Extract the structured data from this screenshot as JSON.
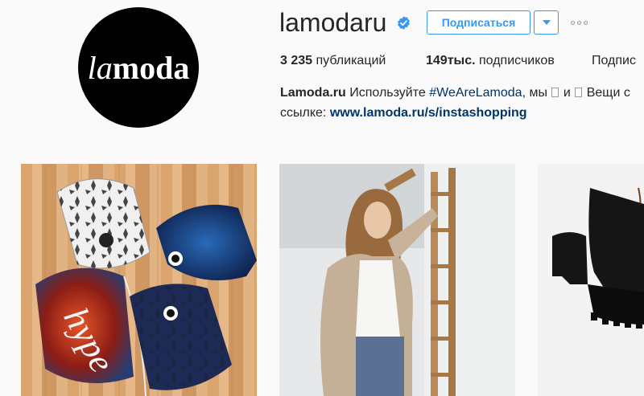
{
  "profile": {
    "logo_text_italic": "la",
    "logo_text_bold": "moda",
    "username": "lamodaru",
    "follow_label": "Подписаться"
  },
  "stats": {
    "posts_count": "3 235",
    "posts_label": "публикаций",
    "followers_count": "149тыс.",
    "followers_label": "подписчиков",
    "following_label": "Подпис"
  },
  "bio": {
    "name": "Lamoda.ru",
    "text1": "Используйте",
    "hashtag": "#WeAreLamoda",
    "text2": ", мы",
    "text3": "и",
    "text4": "Вещи с",
    "line2_text": "ссылке:",
    "link": "www.lamoda.ru/s/instashopping"
  },
  "colors": {
    "accent": "#3897f0",
    "link": "#003569",
    "background": "#fafafa"
  },
  "icons": [
    "verified-badge-icon",
    "chevron-down-icon",
    "more-options-icon"
  ]
}
